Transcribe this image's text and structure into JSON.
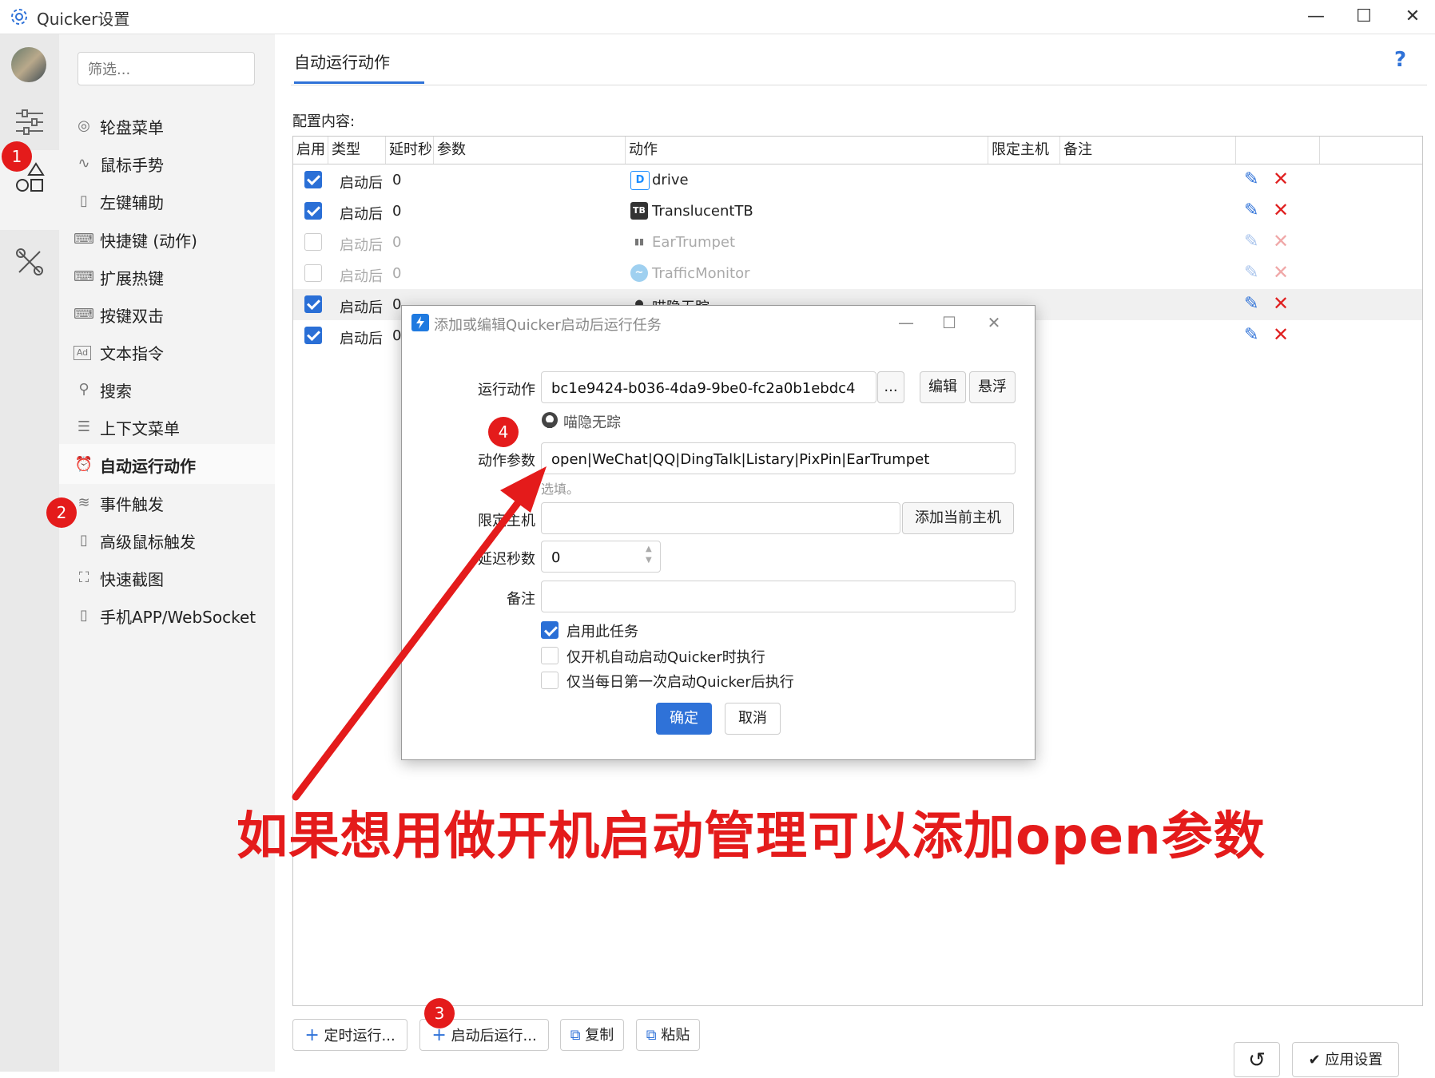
{
  "window": {
    "title": "Quicker设置"
  },
  "filter": {
    "placeholder": "筛选..."
  },
  "nav": [
    {
      "label": "轮盘菜单",
      "icon": "wheel-icon"
    },
    {
      "label": "鼠标手势",
      "icon": "gesture-icon"
    },
    {
      "label": "左键辅助",
      "icon": "mouse-icon"
    },
    {
      "label": "快捷键 (动作)",
      "icon": "keyboard-icon"
    },
    {
      "label": "扩展热键",
      "icon": "keyboard-icon"
    },
    {
      "label": "按键双击",
      "icon": "keyboard-icon"
    },
    {
      "label": "文本指令",
      "icon": "ad-icon"
    },
    {
      "label": "搜索",
      "icon": "search-icon"
    },
    {
      "label": "上下文菜单",
      "icon": "menu-icon"
    },
    {
      "label": "自动运行动作",
      "icon": "alarm-icon"
    },
    {
      "label": "事件触发",
      "icon": "wind-icon"
    },
    {
      "label": "高级鼠标触发",
      "icon": "mouse-icon"
    },
    {
      "label": "快速截图",
      "icon": "screenshot-icon"
    },
    {
      "label": "手机APP/WebSocket",
      "icon": "phone-icon"
    }
  ],
  "main": {
    "tab": "自动运行动作",
    "config_label": "配置内容:",
    "columns": [
      "启用",
      "类型",
      "延时秒",
      "参数",
      "动作",
      "限定主机",
      "备注"
    ],
    "rows": [
      {
        "enabled": true,
        "type": "启动后",
        "delay": "0",
        "action": "drive",
        "icon_glyph": "D",
        "icon_color": "#1a8cff"
      },
      {
        "enabled": true,
        "type": "启动后",
        "delay": "0",
        "action": "TranslucentTB",
        "icon_glyph": "TB",
        "icon_color": "#333333"
      },
      {
        "enabled": false,
        "type": "启动后",
        "delay": "0",
        "action": "EarTrumpet",
        "icon_glyph": "▮▮",
        "icon_color": "#777777"
      },
      {
        "enabled": false,
        "type": "启动后",
        "delay": "0",
        "action": "TrafficMonitor",
        "icon_glyph": "~",
        "icon_color": "#6fb7e8"
      },
      {
        "enabled": true,
        "type": "启动后",
        "delay": "0",
        "action": "喵隐无踪",
        "icon_glyph": "●",
        "icon_color": "#333333"
      },
      {
        "enabled": true,
        "type": "启动后",
        "delay": "0",
        "action": "",
        "icon_glyph": "",
        "icon_color": "#333333"
      }
    ],
    "buttons": {
      "timed": "定时运行...",
      "after_start": "启动后运行...",
      "copy": "复制",
      "paste": "粘贴",
      "apply": "应用设置"
    }
  },
  "dialog": {
    "title": "添加或编辑Quicker启动后运行任务",
    "run_action_label": "运行动作",
    "run_action_value": "bc1e9424-b036-4da9-9be0-fc2a0b1ebdc4",
    "browse_label": "...",
    "edit_label": "编辑",
    "float_label": "悬浮",
    "action_name": "喵隐无踪",
    "param_label": "动作参数",
    "param_value": "open|WeChat|QQ|DingTalk|Listary|PixPin|EarTrumpet",
    "param_hint": "选填。",
    "host_label": "限定主机",
    "host_value": "",
    "add_host_label": "添加当前主机",
    "delay_label": "延迟秒数",
    "delay_value": "0",
    "note_label": "备注",
    "note_value": "",
    "options": [
      {
        "label": "启用此任务",
        "checked": true
      },
      {
        "label": "仅开机自动启动Quicker时执行",
        "checked": false
      },
      {
        "label": "仅当每日第一次启动Quicker后执行",
        "checked": false
      }
    ],
    "ok_label": "确定",
    "cancel_label": "取消"
  },
  "annotations": {
    "badges": [
      "1",
      "2",
      "3",
      "4"
    ],
    "caption": "如果想用做开机启动管理可以添加open参数",
    "color": "#e41b1b"
  }
}
